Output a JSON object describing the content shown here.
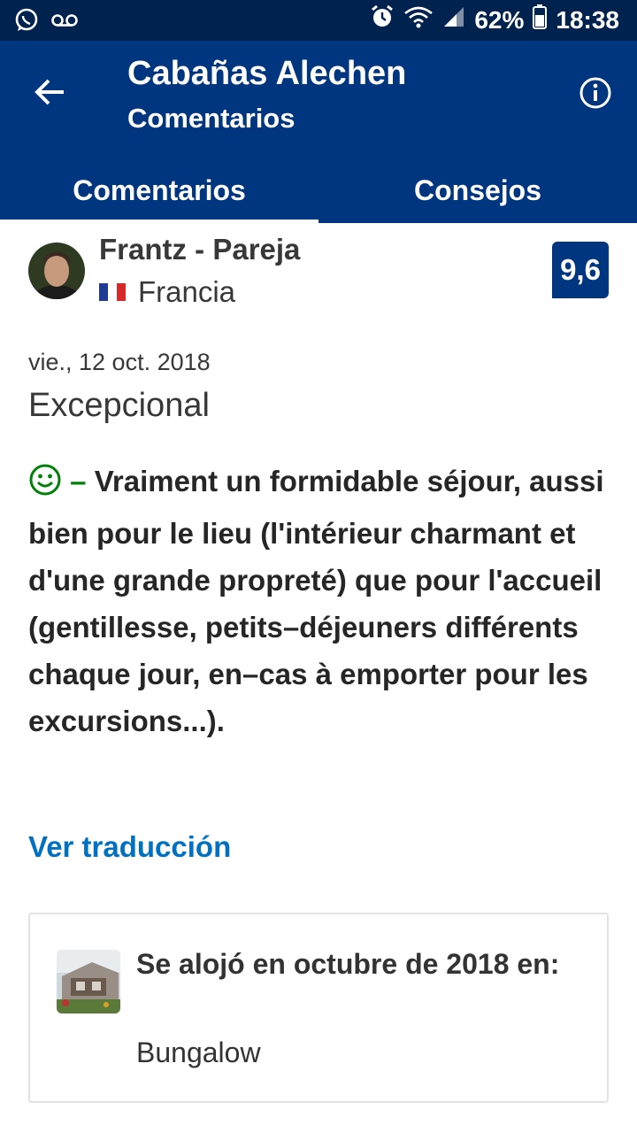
{
  "status_bar": {
    "battery": "62%",
    "time": "18:38",
    "icons": [
      "whatsapp-icon",
      "voicemail-icon",
      "alarm-icon",
      "wifi-icon",
      "signal-icon",
      "battery-icon"
    ]
  },
  "header": {
    "title": "Cabañas Alechen",
    "subtitle": "Comentarios",
    "back_icon": "back-arrow-icon",
    "info_icon": "info-icon"
  },
  "tabs": [
    {
      "label": "Comentarios",
      "active": true
    },
    {
      "label": "Consejos",
      "active": false
    }
  ],
  "review": {
    "reviewer": "Frantz - Pareja",
    "country": "Francia",
    "score": "9,6",
    "date": "vie., 12 oct. 2018",
    "headline": "Excepcional",
    "positive_prefix": "–",
    "text": "Vraiment un formidable séjour, aussi bien pour le lieu (l'intérieur charmant et d'une grande propreté) que pour l'accueil (gentillesse, petits–déjeuners différents chaque jour, en–cas à emporter pour les excursions...).",
    "translate_link": "Ver traducción"
  },
  "stay": {
    "text": "Se alojó en octubre de 2018 en:",
    "room": "Bungalow"
  },
  "colors": {
    "brand": "#003580",
    "status_bar": "#00224f",
    "positive": "#008009",
    "link": "#0071c2"
  }
}
